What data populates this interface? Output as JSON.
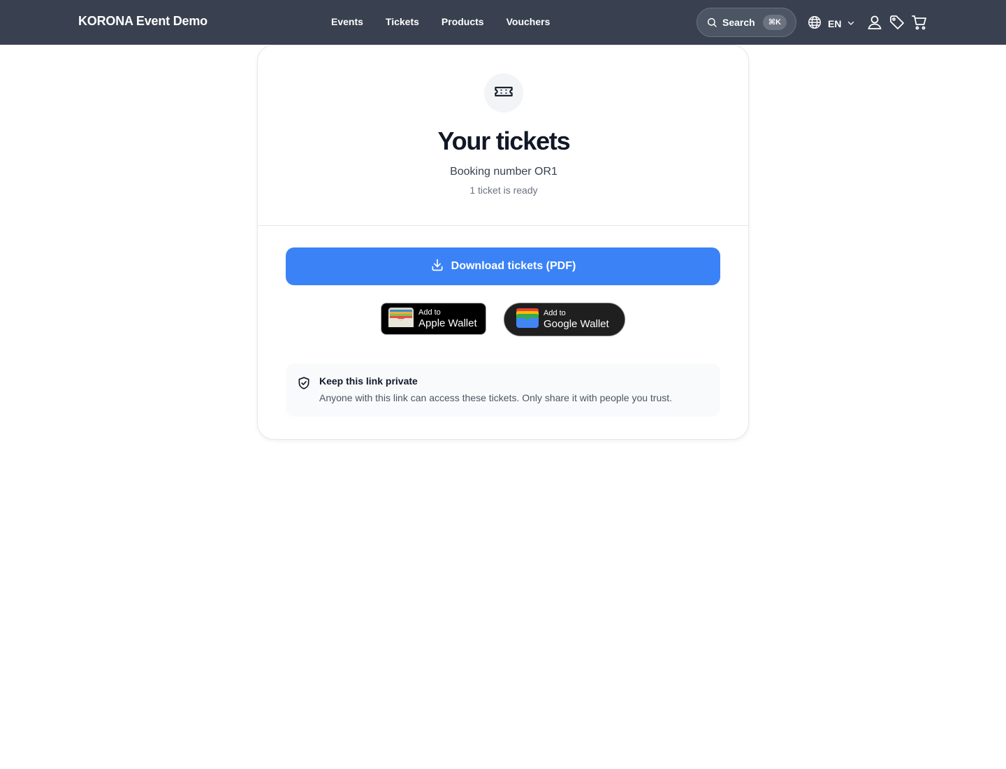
{
  "header": {
    "brand": "KORONA Event Demo",
    "nav": [
      "Events",
      "Tickets",
      "Products",
      "Vouchers"
    ],
    "search_label": "Search",
    "search_shortcut": "⌘K",
    "language": "EN",
    "icons": [
      "search-icon",
      "globe-icon",
      "chevron-down-icon",
      "user-icon",
      "tag-icon",
      "cart-icon"
    ]
  },
  "card": {
    "title": "Your tickets",
    "booking": "Booking number OR1",
    "ready": "1 ticket is ready",
    "download_label": "Download tickets (PDF)",
    "apple_wallet": {
      "small": "Add to",
      "big": "Apple Wallet"
    },
    "google_wallet": {
      "small": "Add to",
      "big": "Google Wallet"
    },
    "notice": {
      "title": "Keep this link private",
      "body": "Anyone with this link can access these tickets. Only share it with people you trust."
    }
  },
  "colors": {
    "header_bg": "#394150",
    "primary": "#3b82f6",
    "text_dark": "#111827",
    "text_muted": "#6b7280"
  }
}
